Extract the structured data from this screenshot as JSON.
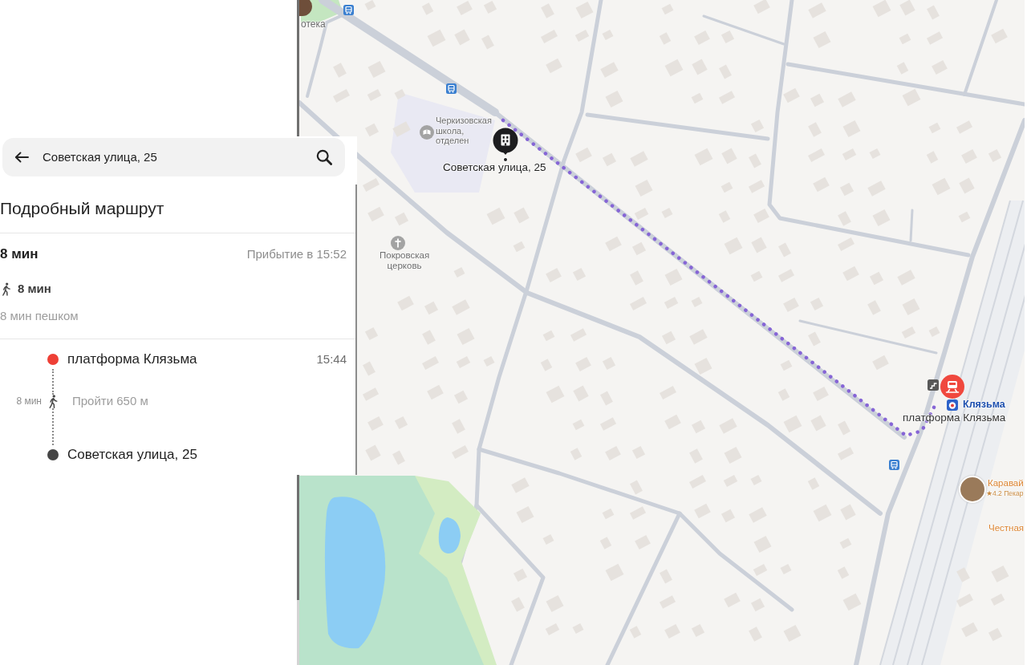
{
  "search": {
    "value": "Советская улица, 25"
  },
  "route_panel": {
    "title": "Подробный маршрут",
    "duration": "8 мин",
    "arrival": "Прибытие в 15:52",
    "modes": [
      {
        "kind": "walk",
        "duration": "8 мин"
      }
    ],
    "summary": "8 мин пешком",
    "steps": [
      {
        "kind": "stop",
        "name": "платформа Клязьма",
        "time": "15:44",
        "color": "#ee4036"
      },
      {
        "kind": "walk",
        "duration": "8 мин",
        "instruction": "Пройти 650 м"
      },
      {
        "kind": "stop",
        "name": "Советская улица, 25",
        "color": "#454545"
      }
    ]
  },
  "map": {
    "places": [
      {
        "kind": "photo_poi",
        "label": "отека"
      },
      {
        "kind": "school",
        "label": "Черкизовская школа, отделен"
      },
      {
        "kind": "church",
        "label": "Покровская церковь"
      },
      {
        "kind": "destination",
        "label": "Советская улица, 25"
      },
      {
        "kind": "station",
        "label": "платформа Клязьма",
        "station_name": "Клязьма"
      },
      {
        "kind": "business",
        "label": "Каравай",
        "detail": "★4.2 Пекар"
      },
      {
        "kind": "shop",
        "label": "Честная"
      }
    ]
  }
}
